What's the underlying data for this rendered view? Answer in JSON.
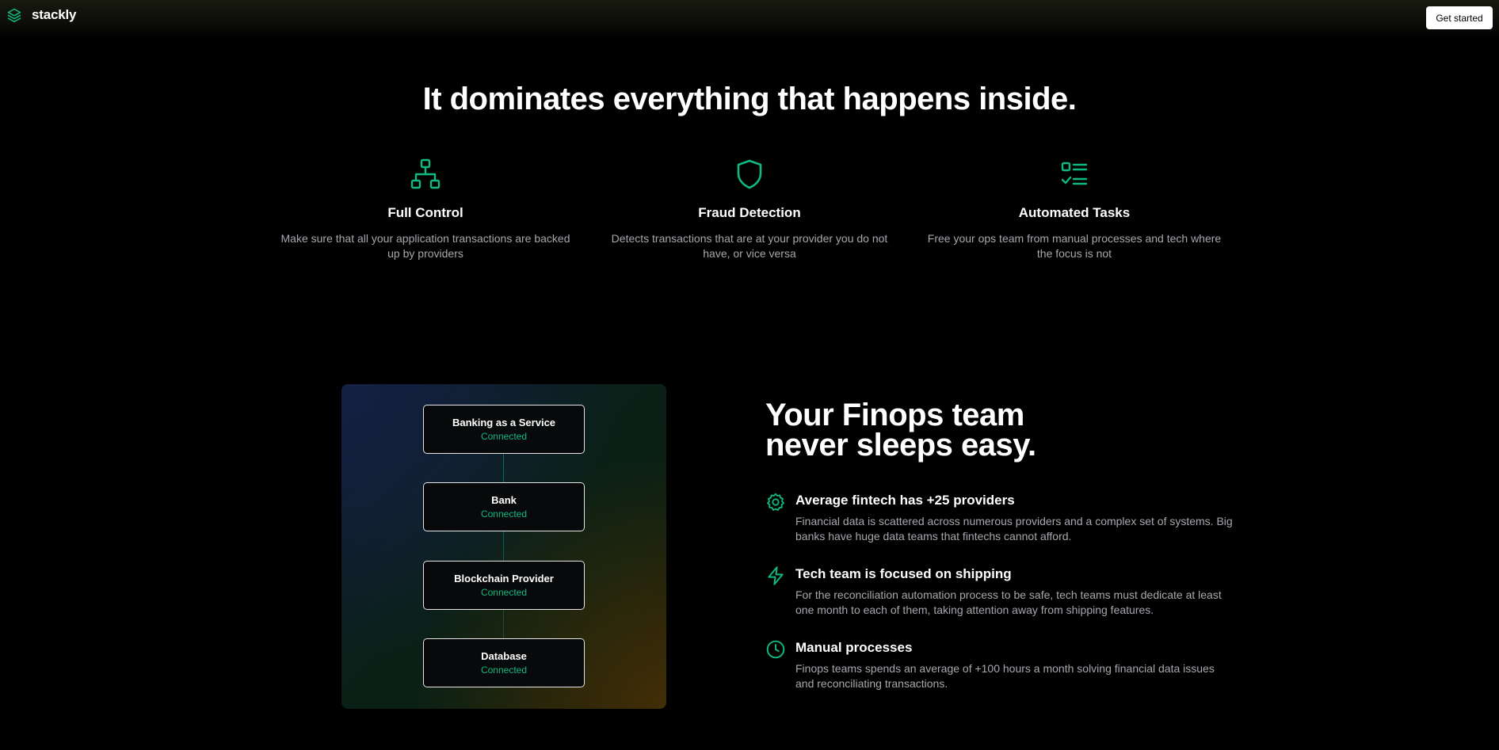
{
  "brand": {
    "name": "stackly",
    "icon": "layers-icon",
    "accent": "#10b981"
  },
  "header": {
    "cta_label": "Get started"
  },
  "hero": {
    "title": "It dominates everything that happens inside."
  },
  "features": [
    {
      "icon": "sitemap-icon",
      "title": "Full Control",
      "text": "Make sure that all your application transactions are backed up by providers"
    },
    {
      "icon": "shield-icon",
      "title": "Fraud Detection",
      "text": "Detects transactions that are at your provider you do not have, or vice versa"
    },
    {
      "icon": "checklist-icon",
      "title": "Automated Tasks",
      "text": "Free your ops team from manual processes and tech where the focus is not"
    }
  ],
  "diagram": {
    "nodes": [
      {
        "name": "Banking as a Service",
        "status": "Connected"
      },
      {
        "name": "Bank",
        "status": "Connected"
      },
      {
        "name": "Blockchain Provider",
        "status": "Connected"
      },
      {
        "name": "Database",
        "status": "Connected"
      }
    ]
  },
  "finops": {
    "title_line1": "Your Finops team",
    "title_line2": "never sleeps easy.",
    "points": [
      {
        "icon": "gear-icon",
        "title": "Average fintech has +25 providers",
        "text": "Financial data is scattered across numerous providers and a complex set of systems. Big banks have huge data teams that fintechs cannot afford."
      },
      {
        "icon": "lightning-icon",
        "title": "Tech team is focused on shipping",
        "text": "For the reconciliation automation process to be safe, tech teams must dedicate at least one month to each of them, taking attention away from shipping features."
      },
      {
        "icon": "clock-icon",
        "title": "Manual processes",
        "text": "Finops teams spends an average of +100 hours a month solving financial data issues and reconciliating transactions."
      }
    ]
  }
}
